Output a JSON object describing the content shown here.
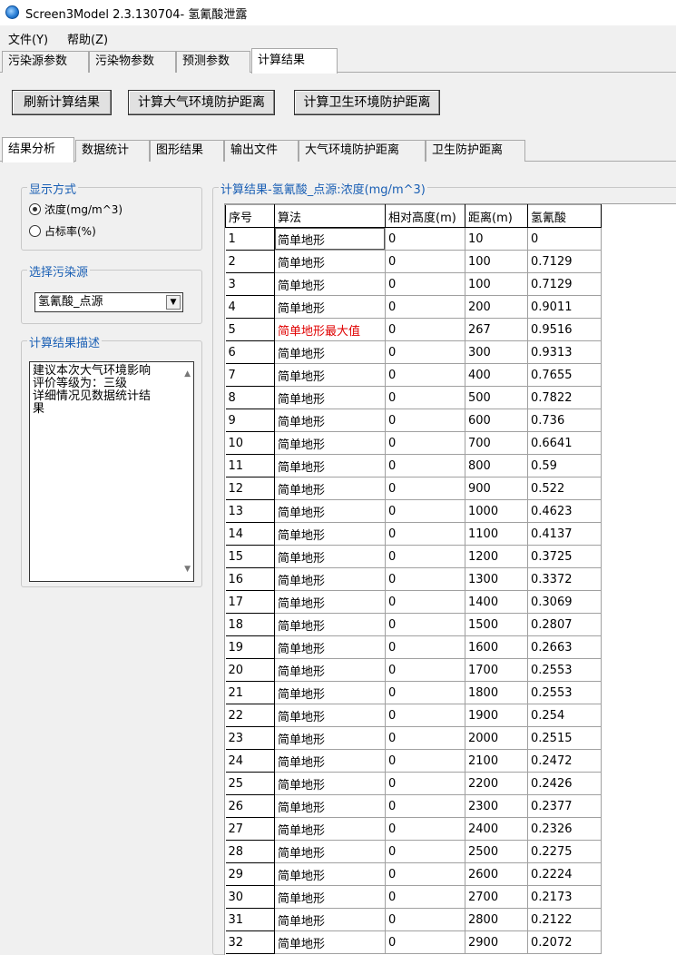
{
  "window": {
    "title": "Screen3Model 2.3.130704- 氢氰酸泄露"
  },
  "menu": [
    "文件(Y)",
    "帮助(Z)"
  ],
  "main_tabs": [
    "污染源参数",
    "污染物参数",
    "预测参数",
    "计算结果"
  ],
  "active_main_tab": "计算结果",
  "buttons": {
    "refresh": "刷新计算结果",
    "air_distance": "计算大气环境防护距离",
    "sanitary_distance": "计算卫生环境防护距离"
  },
  "sub_tabs": [
    "结果分析",
    "数据统计",
    "图形结果",
    "输出文件",
    "大气环境防护距离",
    "卫生防护距离"
  ],
  "active_sub_tab": "结果分析",
  "display_mode": {
    "title": "显示方式",
    "option_concentration": "浓度(mg/m^3)",
    "option_ratio": "占标率(%)",
    "selected": "浓度(mg/m^3)"
  },
  "pollution_source": {
    "title": "选择污染源",
    "selected": "氢氰酸_点源"
  },
  "description": {
    "title": "计算结果描述",
    "lines": [
      "建议本次大气环境影响",
      "评价等级为：三级",
      "详细情况见数据统计结",
      "果"
    ]
  },
  "results": {
    "title": "计算结果-氢氰酸_点源:浓度(mg/m^3)",
    "columns": [
      "序号",
      "算法",
      "相对高度(m)",
      "距离(m)",
      "氢氰酸"
    ],
    "rows": [
      [
        "1",
        "简单地形",
        "0",
        "10",
        "0"
      ],
      [
        "2",
        "简单地形",
        "0",
        "100",
        "0.7129"
      ],
      [
        "3",
        "简单地形",
        "0",
        "100",
        "0.7129"
      ],
      [
        "4",
        "简单地形",
        "0",
        "200",
        "0.9011"
      ],
      [
        "5",
        "简单地形最大值",
        "0",
        "267",
        "0.9516"
      ],
      [
        "6",
        "简单地形",
        "0",
        "300",
        "0.9313"
      ],
      [
        "7",
        "简单地形",
        "0",
        "400",
        "0.7655"
      ],
      [
        "8",
        "简单地形",
        "0",
        "500",
        "0.7822"
      ],
      [
        "9",
        "简单地形",
        "0",
        "600",
        "0.736"
      ],
      [
        "10",
        "简单地形",
        "0",
        "700",
        "0.6641"
      ],
      [
        "11",
        "简单地形",
        "0",
        "800",
        "0.59"
      ],
      [
        "12",
        "简单地形",
        "0",
        "900",
        "0.522"
      ],
      [
        "13",
        "简单地形",
        "0",
        "1000",
        "0.4623"
      ],
      [
        "14",
        "简单地形",
        "0",
        "1100",
        "0.4137"
      ],
      [
        "15",
        "简单地形",
        "0",
        "1200",
        "0.3725"
      ],
      [
        "16",
        "简单地形",
        "0",
        "1300",
        "0.3372"
      ],
      [
        "17",
        "简单地形",
        "0",
        "1400",
        "0.3069"
      ],
      [
        "18",
        "简单地形",
        "0",
        "1500",
        "0.2807"
      ],
      [
        "19",
        "简单地形",
        "0",
        "1600",
        "0.2663"
      ],
      [
        "20",
        "简单地形",
        "0",
        "1700",
        "0.2553"
      ],
      [
        "21",
        "简单地形",
        "0",
        "1800",
        "0.2553"
      ],
      [
        "22",
        "简单地形",
        "0",
        "1900",
        "0.254"
      ],
      [
        "23",
        "简单地形",
        "0",
        "2000",
        "0.2515"
      ],
      [
        "24",
        "简单地形",
        "0",
        "2100",
        "0.2472"
      ],
      [
        "25",
        "简单地形",
        "0",
        "2200",
        "0.2426"
      ],
      [
        "26",
        "简单地形",
        "0",
        "2300",
        "0.2377"
      ],
      [
        "27",
        "简单地形",
        "0",
        "2400",
        "0.2326"
      ],
      [
        "28",
        "简单地形",
        "0",
        "2500",
        "0.2275"
      ],
      [
        "29",
        "简单地形",
        "0",
        "2600",
        "0.2224"
      ],
      [
        "30",
        "简单地形",
        "0",
        "2700",
        "0.2173"
      ],
      [
        "31",
        "简单地形",
        "0",
        "2800",
        "0.2122"
      ],
      [
        "32",
        "简单地形",
        "0",
        "2900",
        "0.2072"
      ]
    ],
    "max_row": "5",
    "highlight_color": "#e00000"
  }
}
